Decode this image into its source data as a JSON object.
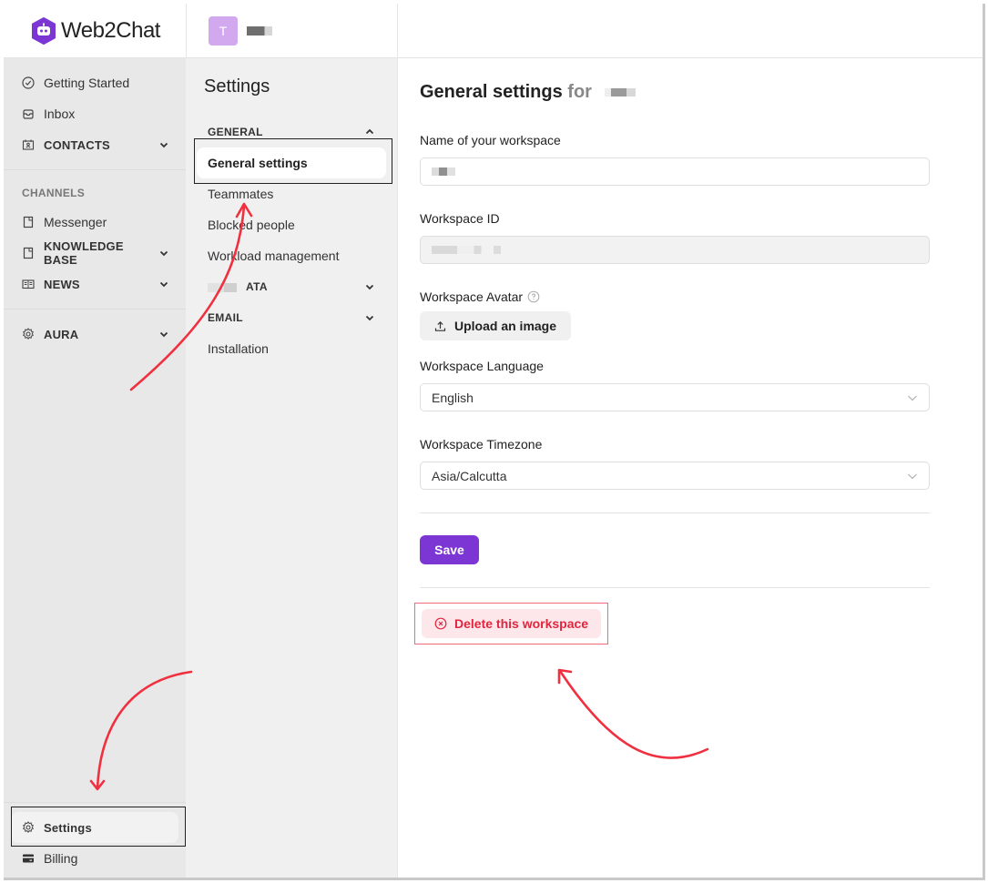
{
  "brand": {
    "name": "Web2Chat",
    "accent": "#7b36d4"
  },
  "workspace": {
    "avatar_letter": "T"
  },
  "sidebar": {
    "items": [
      {
        "label": "Getting Started",
        "icon": "check-circle-icon"
      },
      {
        "label": "Inbox",
        "icon": "inbox-icon"
      },
      {
        "label": "CONTACTS",
        "icon": "contacts-icon",
        "expandable": true
      }
    ],
    "channels_section": "CHANNELS",
    "channel_items": [
      {
        "label": "Messenger",
        "icon": "page-icon"
      },
      {
        "label": "KNOWLEDGE BASE",
        "icon": "page-icon",
        "expandable": true
      },
      {
        "label": "NEWS",
        "icon": "book-icon",
        "expandable": true
      }
    ],
    "aura": {
      "label": "AURA",
      "icon": "gear-icon",
      "expandable": true
    },
    "bottom": [
      {
        "label": "Settings",
        "icon": "gear-icon",
        "active": true
      },
      {
        "label": "Billing",
        "icon": "card-icon"
      }
    ]
  },
  "settings_nav": {
    "title": "Settings",
    "general_group": "GENERAL",
    "general_items": [
      {
        "label": "General settings",
        "active": true
      },
      {
        "label": "Teammates"
      },
      {
        "label": "Blocked people"
      },
      {
        "label": "Workload management"
      }
    ],
    "data_group": "ATA",
    "email_group": "EMAIL",
    "installation": "Installation"
  },
  "content": {
    "title": "General settings",
    "title_for": "for",
    "name_label": "Name of your workspace",
    "id_label": "Workspace ID",
    "avatar_label": "Workspace Avatar",
    "upload_label": "Upload an image",
    "language_label": "Workspace Language",
    "language_value": "English",
    "timezone_label": "Workspace Timezone",
    "timezone_value": "Asia/Calcutta",
    "save_label": "Save",
    "delete_label": "Delete this workspace"
  },
  "annotation_color": "#f0303f"
}
